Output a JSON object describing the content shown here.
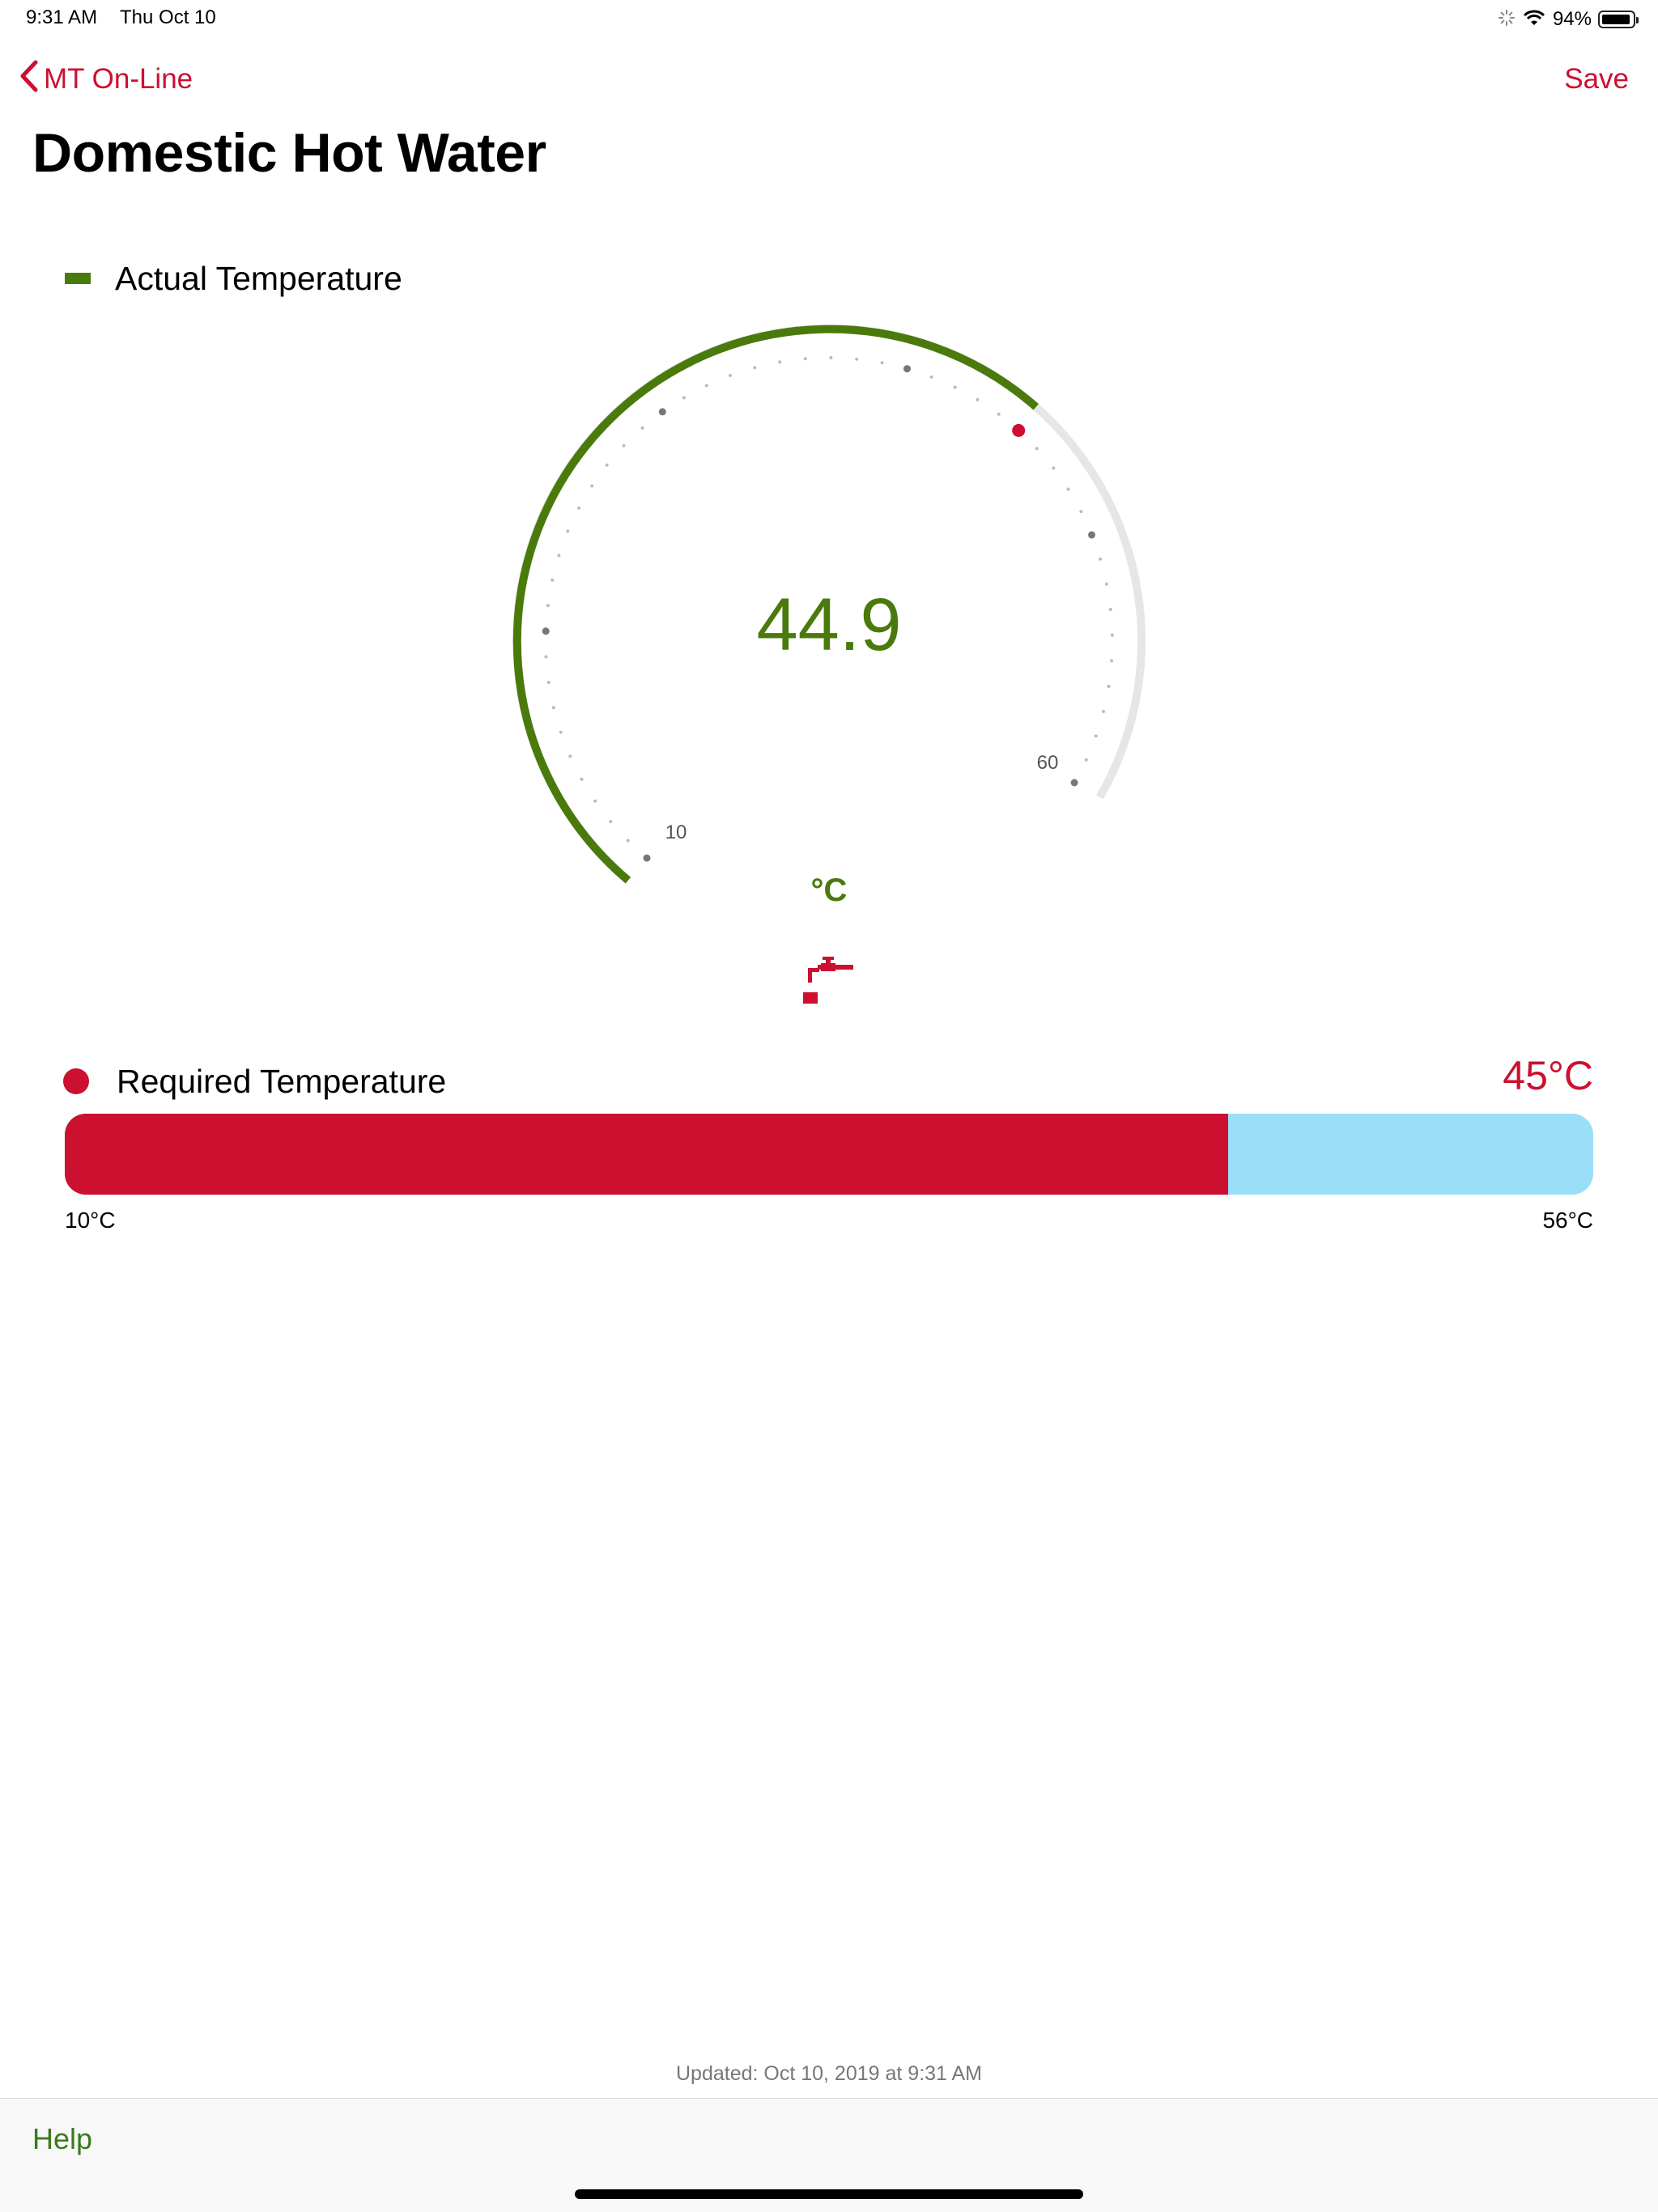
{
  "status_bar": {
    "time": "9:31 AM",
    "date": "Thu Oct 10",
    "battery_percent": "94%",
    "battery_level": 0.94,
    "icons": [
      "activity-spinner-icon",
      "wifi-icon",
      "battery-icon"
    ]
  },
  "nav": {
    "back_label": "MT On-Line",
    "save_label": "Save",
    "back_icon": "chevron-left-icon"
  },
  "title": "Domestic Hot Water",
  "actual": {
    "label": "Actual Temperature",
    "value": "44.9",
    "numeric_value": 44.9,
    "unit": "°C",
    "gauge_min": 10,
    "gauge_max": 60,
    "min_label": "10",
    "max_label": "60",
    "setpoint_marker": 45,
    "color": "#4a7a0c",
    "icon": "water-tap-icon"
  },
  "required": {
    "label": "Required Temperature",
    "value": "45°C",
    "numeric_value": 45,
    "range_min": 10,
    "range_max": 56,
    "min_label": "10°C",
    "max_label": "56°C",
    "fill_color": "#cc1030",
    "track_color": "#9adef8"
  },
  "updated_text": "Updated: Oct 10, 2019 at 9:31 AM",
  "footer": {
    "help_label": "Help"
  },
  "colors": {
    "accent_red": "#cc1030",
    "accent_green": "#4a7a0c",
    "gauge_track": "#e6e6e6"
  }
}
